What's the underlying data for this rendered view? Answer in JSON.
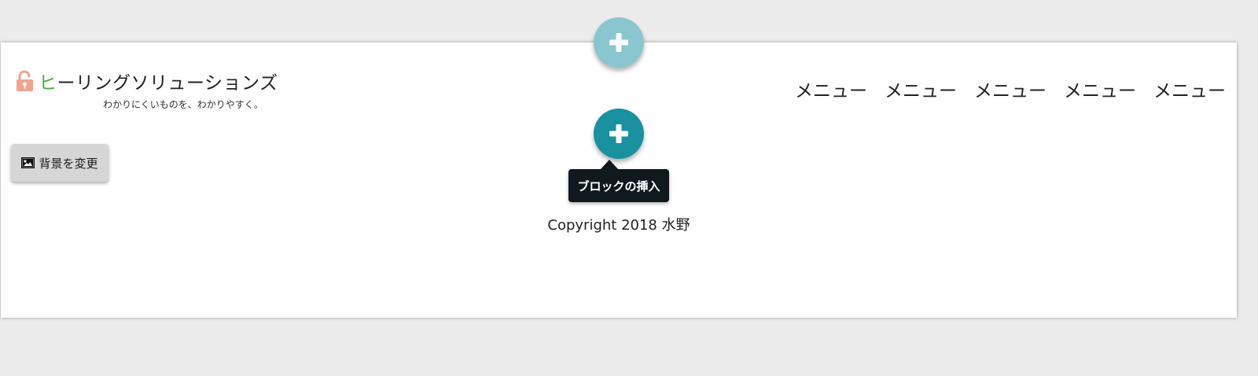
{
  "site": {
    "title_accent": "ヒ",
    "title_rest": "ーリングソリューションズ",
    "tagline": "わかりにくいものを、わかりやすく。"
  },
  "nav": {
    "items": [
      "メニュー",
      "メニュー",
      "メニュー",
      "メニュー",
      "メニュー"
    ]
  },
  "background_button": {
    "label": "背景を変更",
    "icon": "image-icon"
  },
  "insert_block": {
    "tooltip": "ブロックの挿入",
    "icon": "plus-icon"
  },
  "footer": {
    "copyright": "Copyright 2018 水野"
  },
  "colors": {
    "accent_green": "#4aad3f",
    "lock_icon": "#f2a38f",
    "add_button_primary": "#19919f",
    "add_button_faded": "#8ac6d0",
    "tooltip_bg": "#10191d"
  }
}
